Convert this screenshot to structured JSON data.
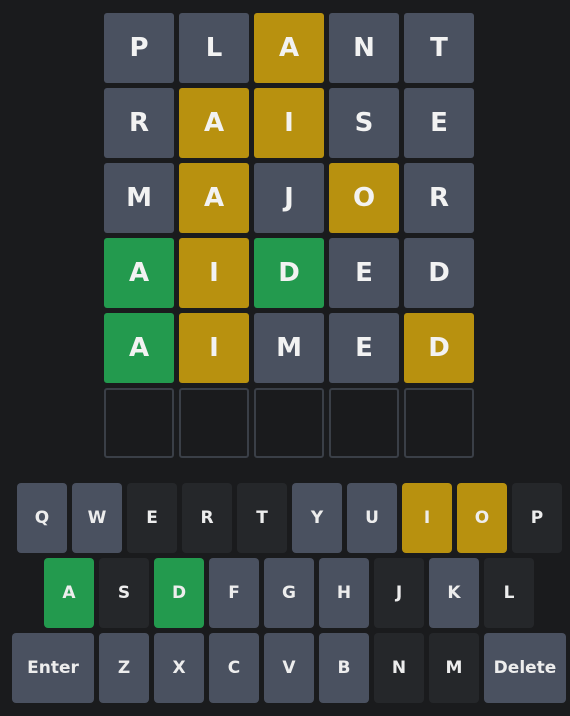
{
  "board": {
    "rows": [
      [
        {
          "letter": "P",
          "state": "absent"
        },
        {
          "letter": "L",
          "state": "absent"
        },
        {
          "letter": "A",
          "state": "present"
        },
        {
          "letter": "N",
          "state": "absent"
        },
        {
          "letter": "T",
          "state": "absent"
        }
      ],
      [
        {
          "letter": "R",
          "state": "absent"
        },
        {
          "letter": "A",
          "state": "present"
        },
        {
          "letter": "I",
          "state": "present"
        },
        {
          "letter": "S",
          "state": "absent"
        },
        {
          "letter": "E",
          "state": "absent"
        }
      ],
      [
        {
          "letter": "M",
          "state": "absent"
        },
        {
          "letter": "A",
          "state": "present"
        },
        {
          "letter": "J",
          "state": "absent"
        },
        {
          "letter": "O",
          "state": "present"
        },
        {
          "letter": "R",
          "state": "absent"
        }
      ],
      [
        {
          "letter": "A",
          "state": "correct"
        },
        {
          "letter": "I",
          "state": "present"
        },
        {
          "letter": "D",
          "state": "correct"
        },
        {
          "letter": "E",
          "state": "absent"
        },
        {
          "letter": "D",
          "state": "absent"
        }
      ],
      [
        {
          "letter": "A",
          "state": "correct"
        },
        {
          "letter": "I",
          "state": "present"
        },
        {
          "letter": "M",
          "state": "absent"
        },
        {
          "letter": "E",
          "state": "absent"
        },
        {
          "letter": "D",
          "state": "present"
        }
      ],
      [
        {
          "letter": "",
          "state": "empty"
        },
        {
          "letter": "",
          "state": "empty"
        },
        {
          "letter": "",
          "state": "empty"
        },
        {
          "letter": "",
          "state": "empty"
        },
        {
          "letter": "",
          "state": "empty"
        }
      ]
    ]
  },
  "keyboard": {
    "rows": [
      [
        {
          "label": "Q",
          "state": "unused"
        },
        {
          "label": "W",
          "state": "unused"
        },
        {
          "label": "E",
          "state": "absent"
        },
        {
          "label": "R",
          "state": "absent"
        },
        {
          "label": "T",
          "state": "absent"
        },
        {
          "label": "Y",
          "state": "unused"
        },
        {
          "label": "U",
          "state": "unused"
        },
        {
          "label": "I",
          "state": "present"
        },
        {
          "label": "O",
          "state": "present"
        },
        {
          "label": "P",
          "state": "absent"
        }
      ],
      [
        {
          "label": "A",
          "state": "correct"
        },
        {
          "label": "S",
          "state": "absent"
        },
        {
          "label": "D",
          "state": "correct"
        },
        {
          "label": "F",
          "state": "unused"
        },
        {
          "label": "G",
          "state": "unused"
        },
        {
          "label": "H",
          "state": "unused"
        },
        {
          "label": "J",
          "state": "absent"
        },
        {
          "label": "K",
          "state": "unused"
        },
        {
          "label": "L",
          "state": "absent"
        }
      ],
      [
        {
          "label": "Enter",
          "state": "unused",
          "wide": true
        },
        {
          "label": "Z",
          "state": "unused"
        },
        {
          "label": "X",
          "state": "unused"
        },
        {
          "label": "C",
          "state": "unused"
        },
        {
          "label": "V",
          "state": "unused"
        },
        {
          "label": "B",
          "state": "unused"
        },
        {
          "label": "N",
          "state": "absent"
        },
        {
          "label": "M",
          "state": "absent"
        },
        {
          "label": "Delete",
          "state": "unused",
          "wide": true
        }
      ]
    ]
  },
  "colors": {
    "background": "#1a1b1d",
    "absent_tile": "#4a5160",
    "present": "#b8910f",
    "correct": "#239a4e",
    "absent_key": "#25272a",
    "unused_key": "#4a5160",
    "empty_border": "#3a3f47"
  }
}
